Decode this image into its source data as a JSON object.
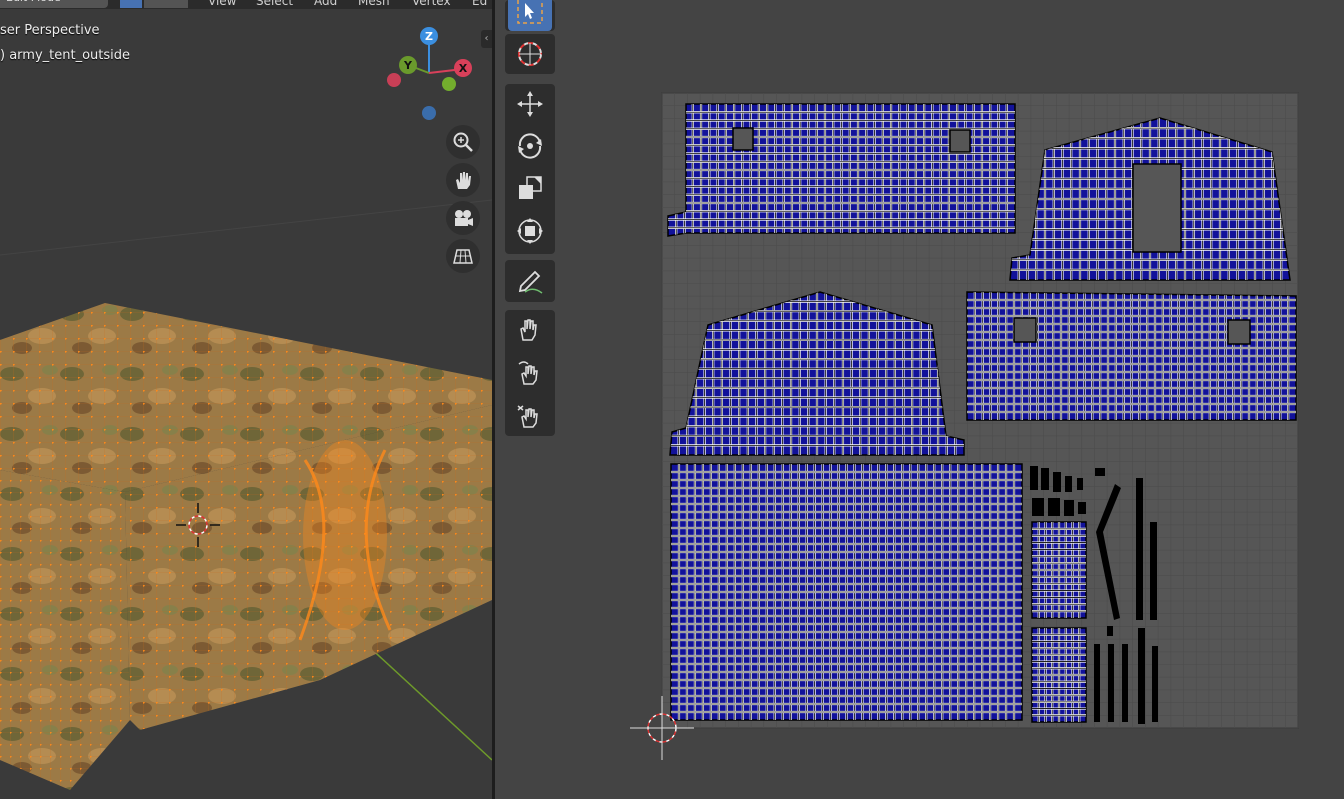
{
  "viewport": {
    "perspective_label": "ser Perspective",
    "object_label": ") army_tent_outside",
    "mode_label": "Edit Mode",
    "menus": [
      "View",
      "Select",
      "Add",
      "Mesh",
      "Vertex",
      "Ed"
    ],
    "gizmo": {
      "z": "Z",
      "y": "Y",
      "x": "X"
    },
    "nav_buttons": [
      "zoom-icon",
      "hand-pan-icon",
      "camera-icon",
      "grid-ortho-icon"
    ]
  },
  "toolbar": {
    "tools": [
      "select-box-icon",
      "cursor-icon",
      "move-icon",
      "rotate-icon",
      "scale-icon",
      "transform-icon",
      "annotate-icon",
      "grab-icon",
      "relax-icon",
      "pinch-icon"
    ],
    "active_tool": "select-box-icon"
  },
  "colors": {
    "uv_face": "#12129a",
    "vertex": "#ff8a1a",
    "accent": "#4772b3",
    "axis_x": "#d8405a",
    "axis_y": "#6a9a2c",
    "axis_z": "#3b8fe0"
  }
}
